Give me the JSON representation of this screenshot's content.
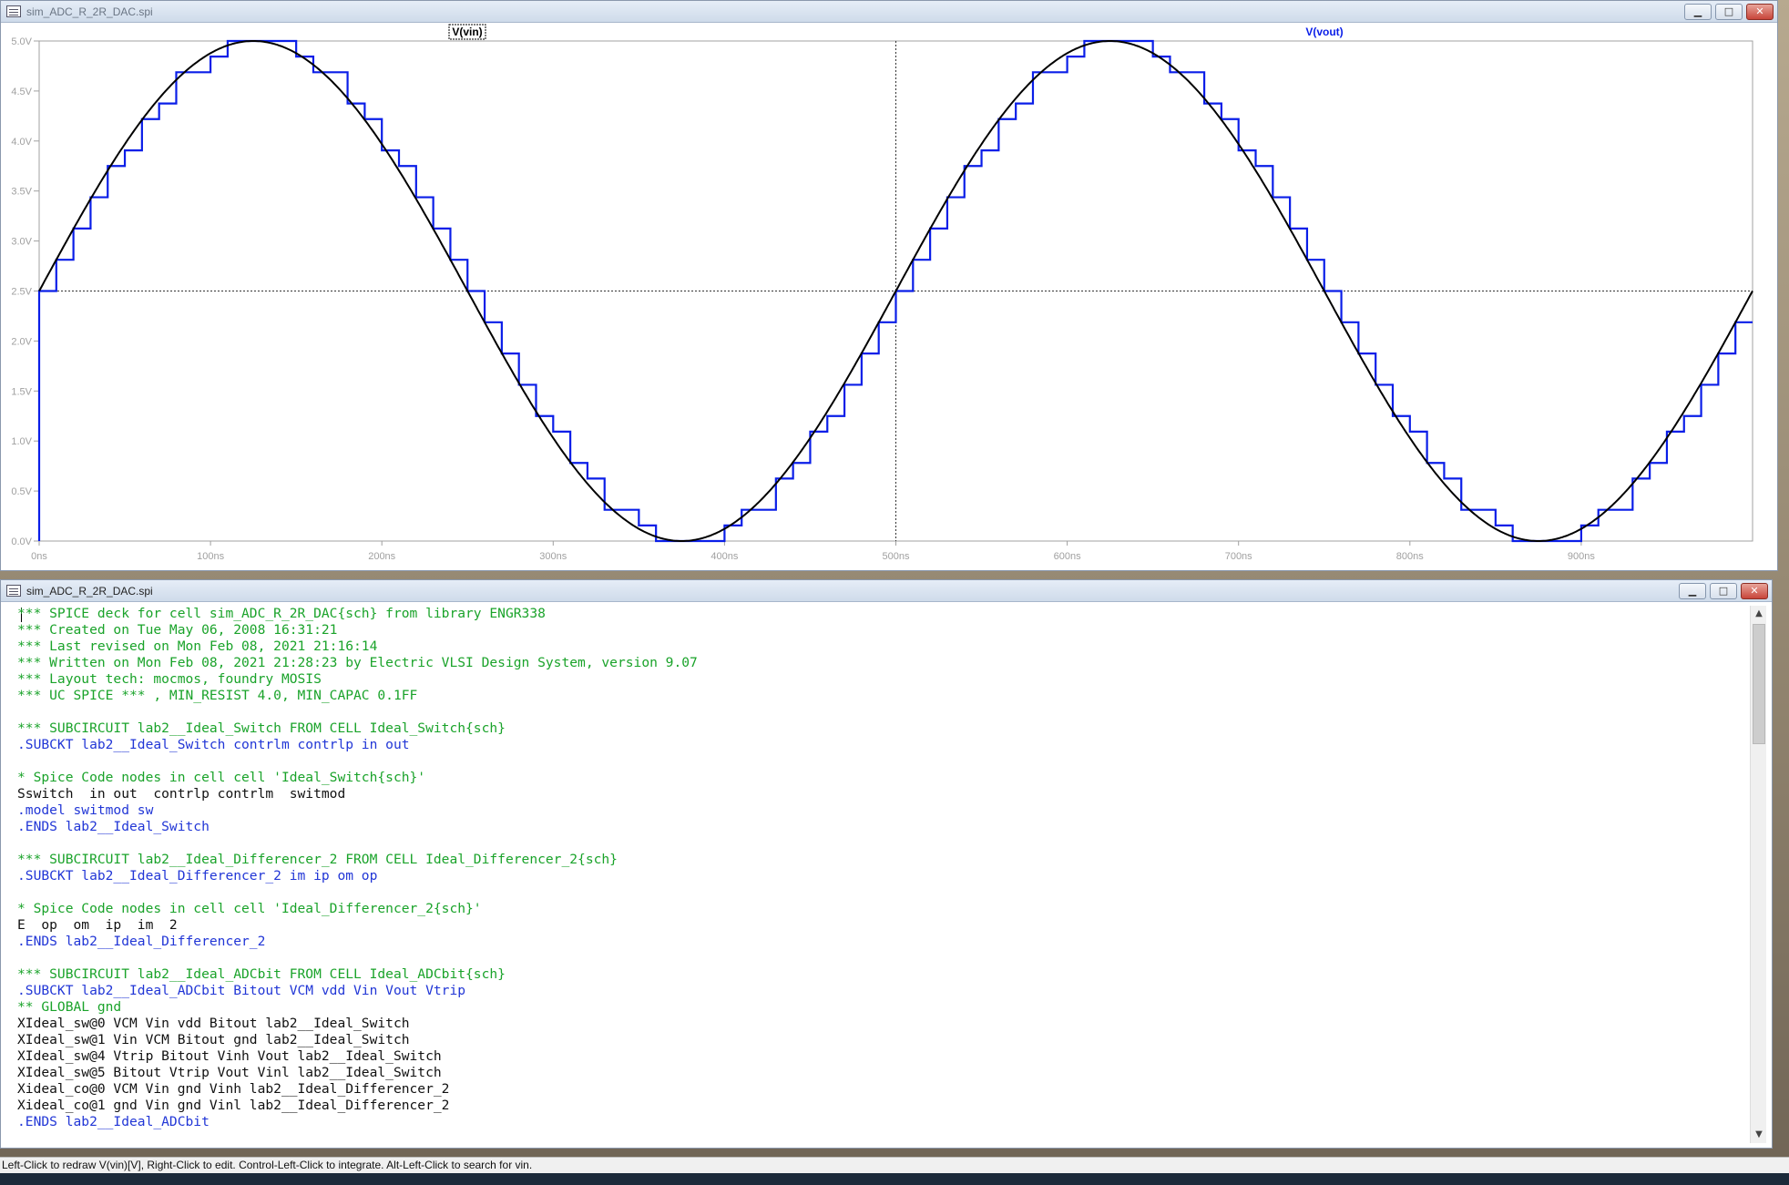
{
  "waveform_window": {
    "title": "sim_ADC_R_2R_DAC.spi",
    "buttons": {
      "minimize": "▁",
      "maximize": "□",
      "close": "✕"
    },
    "traces": [
      {
        "name": "V(vin)",
        "color": "#000000"
      },
      {
        "name": "V(vout)",
        "color": "#0a1ee8"
      }
    ],
    "y_ticks": [
      "5.0V",
      "4.5V",
      "4.0V",
      "3.5V",
      "3.0V",
      "2.5V",
      "2.0V",
      "1.5V",
      "1.0V",
      "0.5V",
      "0.0V"
    ],
    "x_ticks": [
      "0ns",
      "100ns",
      "200ns",
      "300ns",
      "400ns",
      "500ns",
      "600ns",
      "700ns",
      "800ns",
      "900ns"
    ]
  },
  "chart_data": {
    "type": "line",
    "x_unit": "ns",
    "y_unit": "V",
    "xlim": [
      0,
      1000
    ],
    "ylim": [
      0,
      5
    ],
    "cursor_x": 500,
    "cursor_y": 2.5,
    "series": [
      {
        "name": "V(vin)",
        "signal": "sine",
        "offset_v": 2.5,
        "amplitude_v": 2.5,
        "period_ns": 500
      },
      {
        "name": "V(vout)",
        "signal": "staircase",
        "offset_v": 2.5,
        "amplitude_v": 2.5,
        "period_ns": 500,
        "step_ns": 10,
        "levels": 32
      }
    ]
  },
  "text_window": {
    "title": "sim_ADC_R_2R_DAC.spi",
    "buttons": {
      "minimize": "▁",
      "maximize": "□",
      "close": "✕"
    },
    "lines": [
      {
        "text": "*** SPICE deck for cell sim_ADC_R_2R_DAC{sch} from library ENGR338",
        "color": "green"
      },
      {
        "text": "*** Created on Tue May 06, 2008 16:31:21",
        "color": "green"
      },
      {
        "text": "*** Last revised on Mon Feb 08, 2021 21:16:14",
        "color": "green"
      },
      {
        "text": "*** Written on Mon Feb 08, 2021 21:28:23 by Electric VLSI Design System, version 9.07",
        "color": "green"
      },
      {
        "text": "*** Layout tech: mocmos, foundry MOSIS",
        "color": "green"
      },
      {
        "text": "*** UC SPICE *** , MIN_RESIST 4.0, MIN_CAPAC 0.1FF",
        "color": "green"
      },
      {
        "text": "",
        "color": "black"
      },
      {
        "text": "*** SUBCIRCUIT lab2__Ideal_Switch FROM CELL Ideal_Switch{sch}",
        "color": "green"
      },
      {
        "text": ".SUBCKT lab2__Ideal_Switch contrlm contrlp in out",
        "color": "blue"
      },
      {
        "text": "",
        "color": "black"
      },
      {
        "text": "* Spice Code nodes in cell cell 'Ideal_Switch{sch}'",
        "color": "green"
      },
      {
        "text": "Sswitch  in out  contrlp contrlm  switmod",
        "color": "black"
      },
      {
        "text": ".model switmod sw",
        "color": "blue"
      },
      {
        "text": ".ENDS lab2__Ideal_Switch",
        "color": "blue"
      },
      {
        "text": "",
        "color": "black"
      },
      {
        "text": "*** SUBCIRCUIT lab2__Ideal_Differencer_2 FROM CELL Ideal_Differencer_2{sch}",
        "color": "green"
      },
      {
        "text": ".SUBCKT lab2__Ideal_Differencer_2 im ip om op",
        "color": "blue"
      },
      {
        "text": "",
        "color": "black"
      },
      {
        "text": "* Spice Code nodes in cell cell 'Ideal_Differencer_2{sch}'",
        "color": "green"
      },
      {
        "text": "E  op  om  ip  im  2",
        "color": "black"
      },
      {
        "text": ".ENDS lab2__Ideal_Differencer_2",
        "color": "blue"
      },
      {
        "text": "",
        "color": "black"
      },
      {
        "text": "*** SUBCIRCUIT lab2__Ideal_ADCbit FROM CELL Ideal_ADCbit{sch}",
        "color": "green"
      },
      {
        "text": ".SUBCKT lab2__Ideal_ADCbit Bitout VCM vdd Vin Vout Vtrip",
        "color": "blue"
      },
      {
        "text": "** GLOBAL gnd",
        "color": "green"
      },
      {
        "text": "XIdeal_sw@0 VCM Vin vdd Bitout lab2__Ideal_Switch",
        "color": "black"
      },
      {
        "text": "XIdeal_sw@1 Vin VCM Bitout gnd lab2__Ideal_Switch",
        "color": "black"
      },
      {
        "text": "XIdeal_sw@4 Vtrip Bitout Vinh Vout lab2__Ideal_Switch",
        "color": "black"
      },
      {
        "text": "XIdeal_sw@5 Bitout Vtrip Vout Vinl lab2__Ideal_Switch",
        "color": "black"
      },
      {
        "text": "Xideal_co@0 VCM Vin gnd Vinh lab2__Ideal_Differencer_2",
        "color": "black"
      },
      {
        "text": "Xideal_co@1 gnd Vin gnd Vinl lab2__Ideal_Differencer_2",
        "color": "black"
      },
      {
        "text": ".ENDS lab2__Ideal_ADCbit",
        "color": "blue"
      }
    ]
  },
  "status_bar": {
    "text": "Left-Click to redraw V(vin)[V],  Right-Click to edit. Control-Left-Click to integrate. Alt-Left-Click to search for vin."
  }
}
